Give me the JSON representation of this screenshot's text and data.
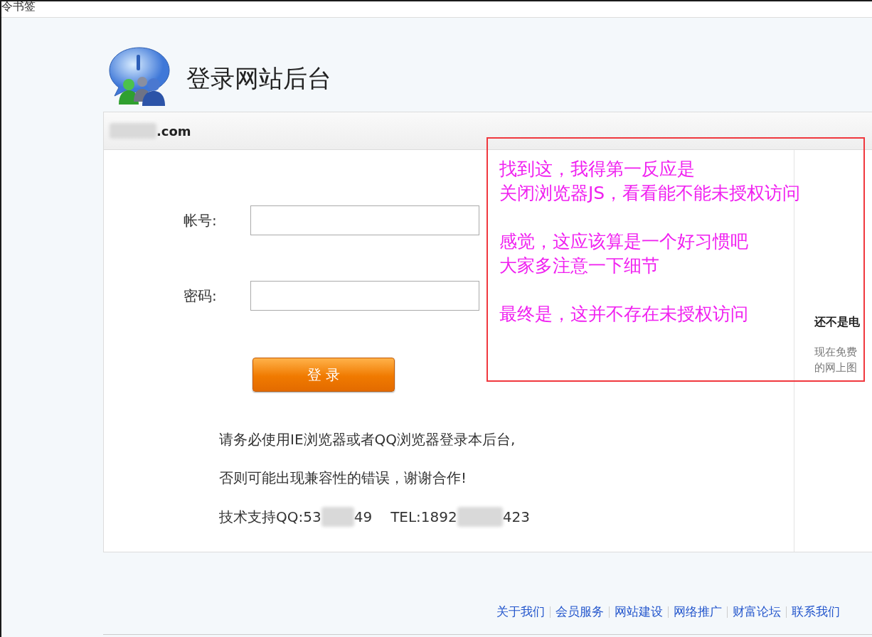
{
  "top_bar": {
    "title": "令书签"
  },
  "header": {
    "title": "登录网站后台"
  },
  "panel": {
    "domain": ".com"
  },
  "form": {
    "fields": [
      {
        "label": "帐号:"
      },
      {
        "label": "密码:"
      }
    ],
    "login_button": "登 录"
  },
  "notice": {
    "lines": [
      "请务必使用IE浏览器或者QQ浏览器登录本后台,",
      "否则可能出现兼容性的错误，谢谢合作!"
    ],
    "contact": [
      "技术支持QQ:53",
      "49",
      "TEL:1892",
      "423"
    ]
  },
  "sidebar": {
    "heading": "还不是电",
    "lines": [
      "现在免费",
      "的网上图"
    ]
  },
  "annotation": {
    "paragraphs": [
      [
        "找到这，我得第一反应是",
        "关闭浏览器JS，看看能不能未授权访问"
      ],
      [
        "感觉，这应该算是一个好习惯吧",
        "大家多注意一下细节"
      ],
      [
        "最终是，这并不存在未授权访问"
      ]
    ]
  },
  "footer": {
    "links": [
      "关于我们",
      "会员服务",
      "网站建设",
      "网络推广",
      "财富论坛",
      "联系我们"
    ]
  }
}
